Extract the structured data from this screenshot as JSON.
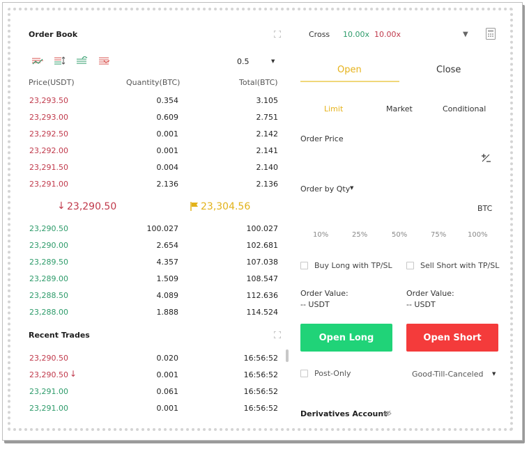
{
  "order_book": {
    "title": "Order Book",
    "precision": "0.5",
    "headers": {
      "price": "Price(USDT)",
      "quantity": "Quantity(BTC)",
      "total": "Total(BTC)"
    },
    "asks": [
      {
        "price": "23,293.50",
        "qty": "0.354",
        "total": "3.105"
      },
      {
        "price": "23,293.00",
        "qty": "0.609",
        "total": "2.751"
      },
      {
        "price": "23,292.50",
        "qty": "0.001",
        "total": "2.142"
      },
      {
        "price": "23,292.00",
        "qty": "0.001",
        "total": "2.141"
      },
      {
        "price": "23,291.50",
        "qty": "0.004",
        "total": "2.140"
      },
      {
        "price": "23,291.00",
        "qty": "2.136",
        "total": "2.136"
      }
    ],
    "last_price": "23,290.50",
    "mark_price": "23,304.56",
    "bids": [
      {
        "price": "23,290.50",
        "qty": "100.027",
        "total": "100.027"
      },
      {
        "price": "23,290.00",
        "qty": "2.654",
        "total": "102.681"
      },
      {
        "price": "23,289.50",
        "qty": "4.357",
        "total": "107.038"
      },
      {
        "price": "23,289.00",
        "qty": "1.509",
        "total": "108.547"
      },
      {
        "price": "23,288.50",
        "qty": "4.089",
        "total": "112.636"
      },
      {
        "price": "23,288.00",
        "qty": "1.888",
        "total": "114.524"
      }
    ]
  },
  "recent_trades": {
    "title": "Recent Trades",
    "rows": [
      {
        "price": "23,290.50",
        "qty": "0.020",
        "time": "16:56:52",
        "side": "sell"
      },
      {
        "price": "23,290.50",
        "qty": "0.001",
        "time": "16:56:52",
        "side": "sell"
      },
      {
        "price": "23,291.00",
        "qty": "0.061",
        "time": "16:56:52",
        "side": "buy"
      },
      {
        "price": "23,291.00",
        "qty": "0.001",
        "time": "16:56:52",
        "side": "buy"
      }
    ]
  },
  "trade_panel": {
    "margin_mode": "Cross",
    "leverage_long": "10.00x",
    "leverage_short": "10.00x",
    "tabs": [
      "Open",
      "Close"
    ],
    "order_types": [
      "Limit",
      "Market",
      "Conditional"
    ],
    "order_price_label": "Order Price",
    "order_by_label": "Order by Qty",
    "unit": "BTC",
    "percent_options": [
      "10%",
      "25%",
      "50%",
      "75%",
      "100%"
    ],
    "buy_tpsl": "Buy Long with TP/SL",
    "sell_tpsl": "Sell Short with TP/SL",
    "order_value_label": "Order Value:",
    "order_value_long": "-- USDT",
    "order_value_short": "-- USDT",
    "open_long": "Open Long",
    "open_short": "Open Short",
    "post_only": "Post-Only",
    "time_in_force": "Good-Till-Canceled",
    "derivatives_account": "Derivatives Account"
  },
  "colors": {
    "buy": "#20d378",
    "sell": "#f43b3b",
    "accent": "#f0b90b",
    "ask": "#c0394b",
    "bid": "#2d9b6a"
  }
}
